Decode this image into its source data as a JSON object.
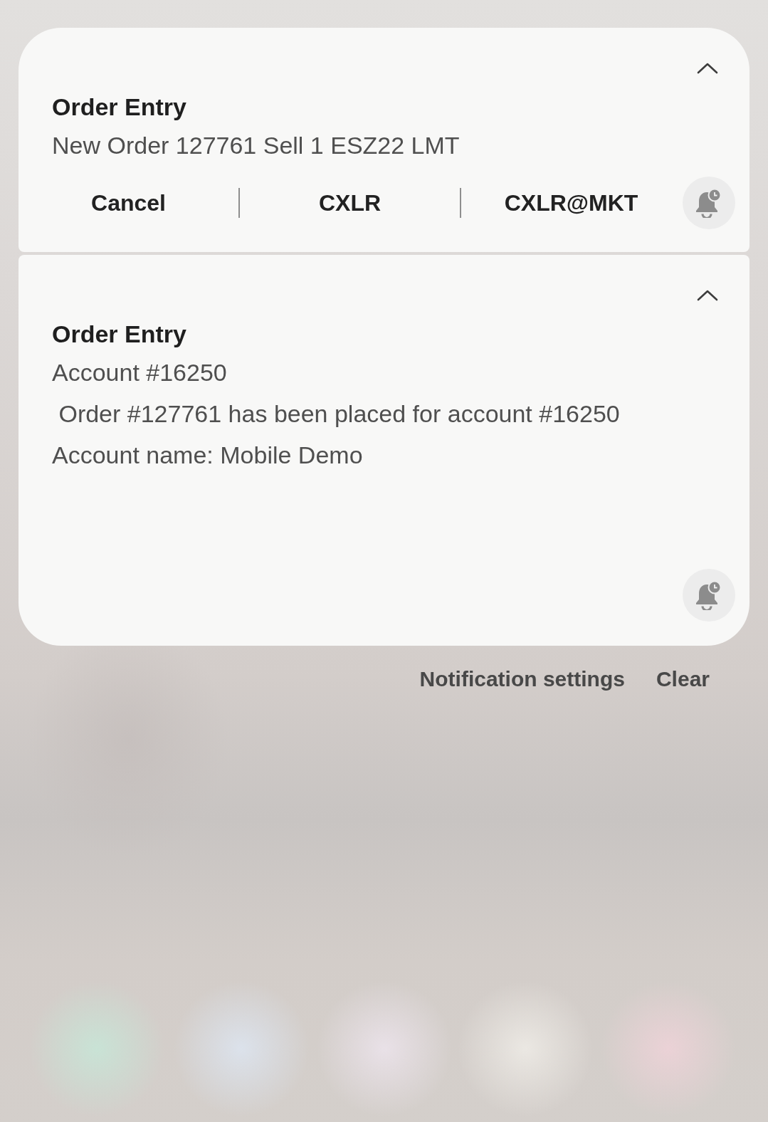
{
  "notifications": [
    {
      "app": "Order Entry",
      "expanded": true,
      "lines": [
        "New Order 127761 Sell 1 ESZ22 LMT"
      ],
      "actions": [
        "Cancel",
        "CXLR",
        "CXLR@MKT"
      ]
    },
    {
      "app": "Order Entry",
      "expanded": true,
      "lines": [
        "Account #16250",
        " Order #127761 has been placed for account #16250",
        "Account name: Mobile Demo"
      ]
    }
  ],
  "footer": {
    "buttons": [
      "Notification settings",
      "Clear"
    ]
  }
}
